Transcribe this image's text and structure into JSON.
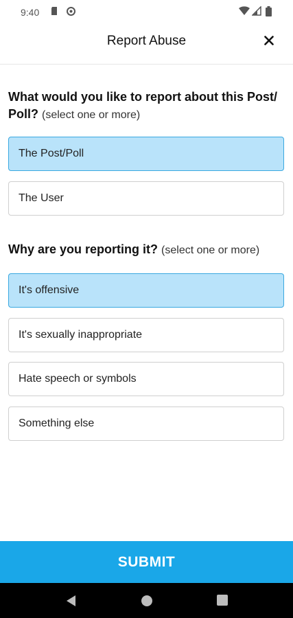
{
  "status_bar": {
    "time": "9:40",
    "icons_left": [
      "sd-card-icon",
      "sync-icon"
    ],
    "icons_right": [
      "wifi-icon",
      "signal-icon",
      "battery-icon"
    ]
  },
  "header": {
    "title": "Report Abuse",
    "close_icon": "close-icon"
  },
  "section1": {
    "question": "What would you like to report about this Post/ Poll?",
    "hint": "(select one or more)",
    "options": [
      {
        "label": "The Post/Poll",
        "selected": true
      },
      {
        "label": "The User",
        "selected": false
      }
    ]
  },
  "section2": {
    "question": "Why are you reporting it?",
    "hint": "(select one or more)",
    "options": [
      {
        "label": "It's offensive",
        "selected": true
      },
      {
        "label": "It's sexually inappropriate",
        "selected": false
      },
      {
        "label": "Hate speech or symbols",
        "selected": false
      },
      {
        "label": "Something else",
        "selected": false
      }
    ]
  },
  "submit_label": "SUBMIT",
  "colors": {
    "accent": "#1aa7e8",
    "selected_bg": "#b9e3fa",
    "selected_border": "#39a8e0"
  },
  "nav": [
    "back-icon",
    "home-icon",
    "recents-icon"
  ]
}
